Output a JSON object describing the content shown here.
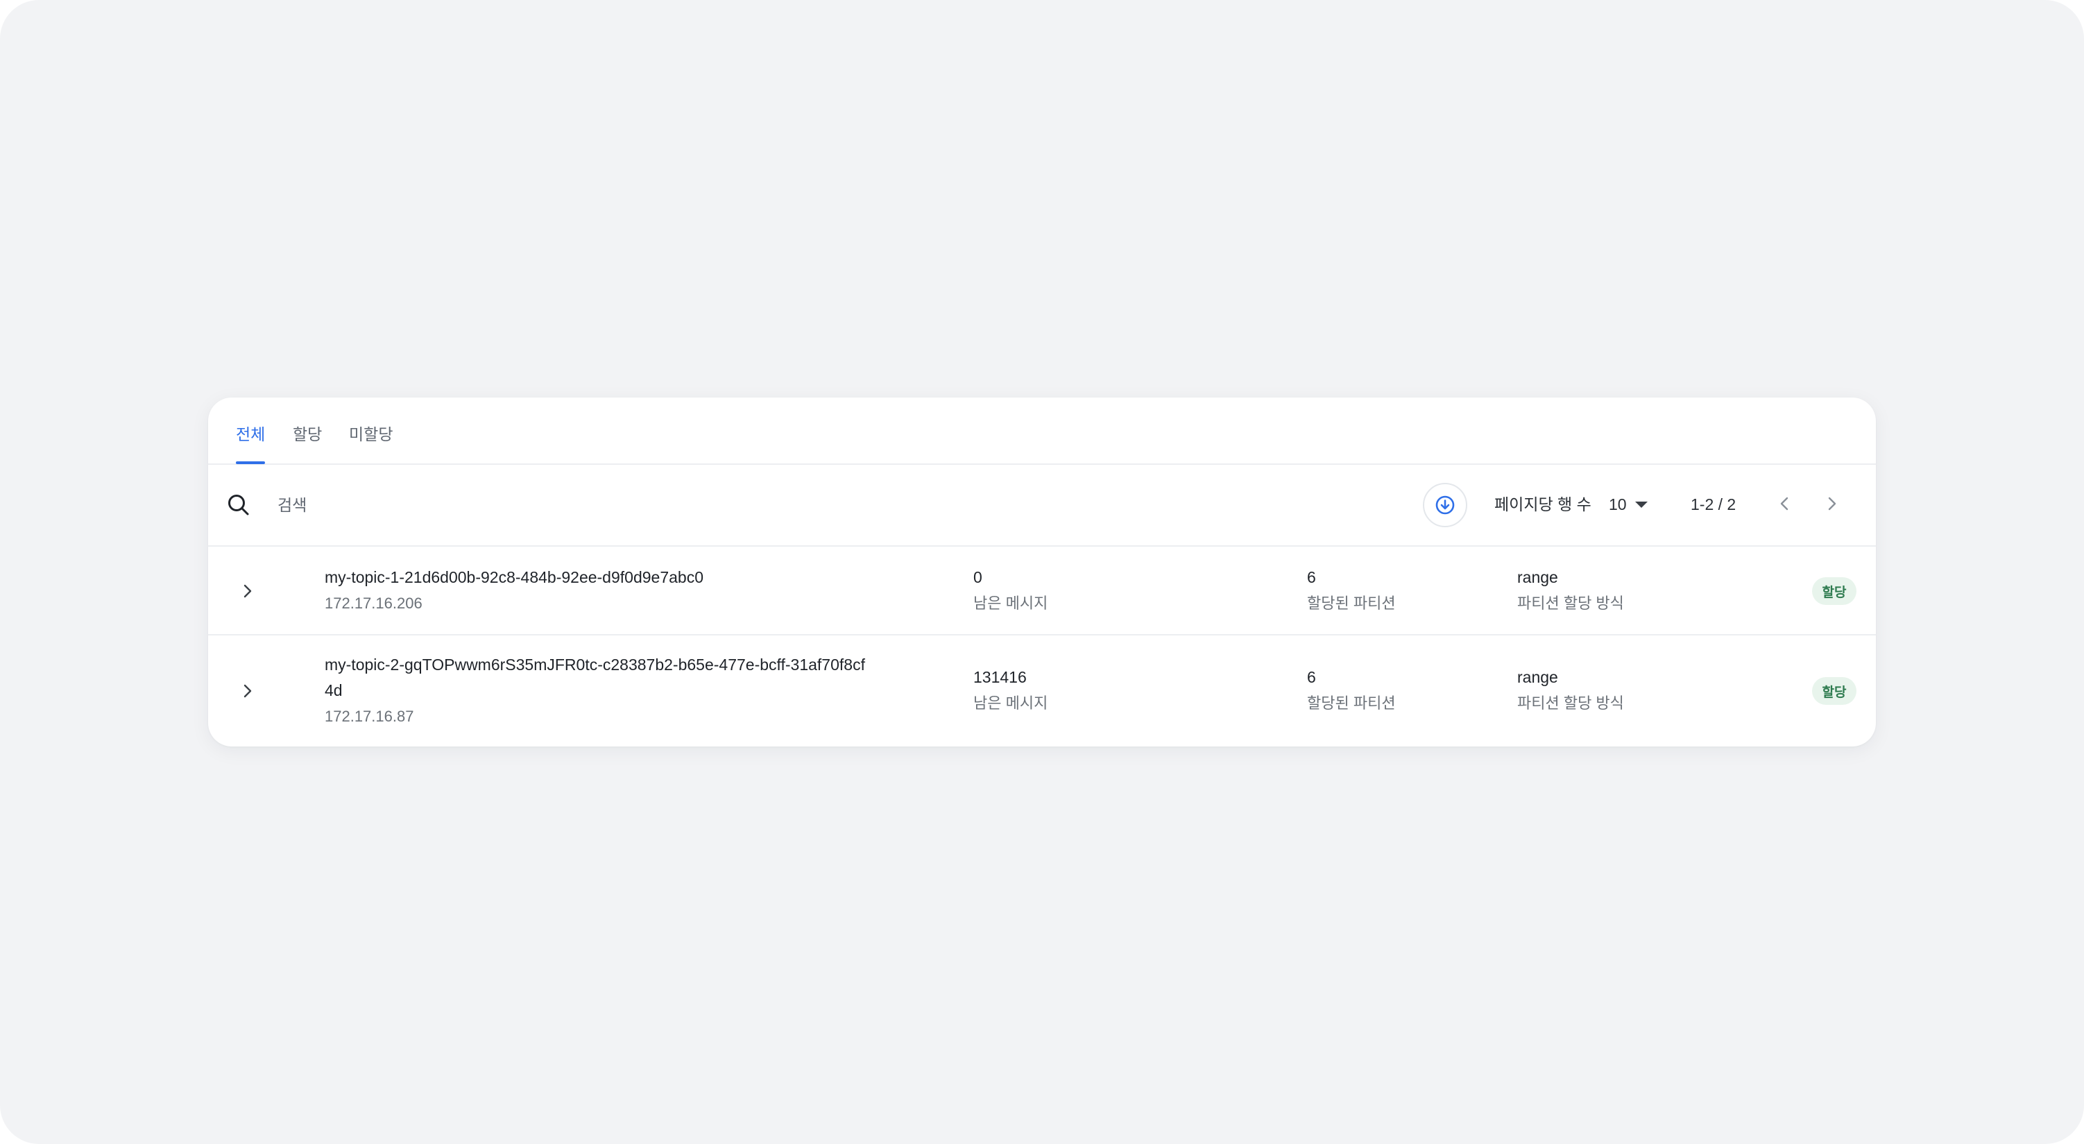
{
  "tabs": [
    {
      "label": "전체",
      "active": true
    },
    {
      "label": "할당",
      "active": false
    },
    {
      "label": "미할당",
      "active": false
    }
  ],
  "toolbar": {
    "search_placeholder": "검색",
    "download_icon": "download-circle-icon",
    "rows_per_page_label": "페이지당 행 수",
    "rows_per_page_value": "10",
    "range_text": "1-2 / 2"
  },
  "rows": [
    {
      "name": "my-topic-1-21d6d00b-92c8-484b-92ee-d9f0d9e7abc0",
      "ip": "172.17.16.206",
      "remaining_messages": "0",
      "remaining_messages_label": "남은 메시지",
      "assigned_partitions": "6",
      "assigned_partitions_label": "할당된 파티션",
      "assignment_method": "range",
      "assignment_method_label": "파티션 할당 방식",
      "status": "할당"
    },
    {
      "name": "my-topic-2-gqTOPwwm6rS35mJFR0tc-c28387b2-b65e-477e-bcff-31af70f8cf4d",
      "ip": "172.17.16.87",
      "remaining_messages": "131416",
      "remaining_messages_label": "남은 메시지",
      "assigned_partitions": "6",
      "assigned_partitions_label": "할당된 파티션",
      "assignment_method": "range",
      "assignment_method_label": "파티션 할당 방식",
      "status": "할당"
    }
  ],
  "colors": {
    "accent": "#2f6fe8",
    "badge_bg": "#e8f4ec",
    "badge_text": "#2e7b4f",
    "page_bg": "#f2f3f5"
  }
}
